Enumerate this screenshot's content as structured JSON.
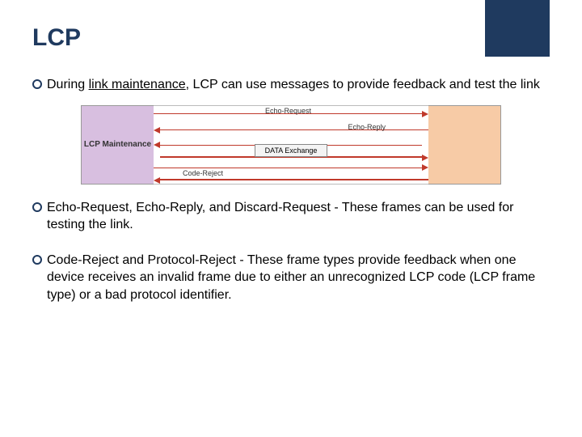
{
  "title": "LCP",
  "bullet1_lead": "During ",
  "bullet1_underline": "link maintenance",
  "bullet1_rest": ", LCP can use messages to provide feedback and test the link",
  "diagram": {
    "left_label": "LCP Maintenance",
    "right_label": "",
    "echo_request": "Echo-Request",
    "echo_reply": "Echo-Reply",
    "data_exchange": "DATA Exchange",
    "code_reject": "Code-Reject"
  },
  "bullet2": "Echo-Request, Echo-Reply, and Discard-Request - These frames can be used for testing the link.",
  "bullet3": "Code-Reject and Protocol-Reject - These frame types provide feedback when one device receives an invalid frame due to either an unrecognized LCP code (LCP frame type) or a bad protocol identifier."
}
